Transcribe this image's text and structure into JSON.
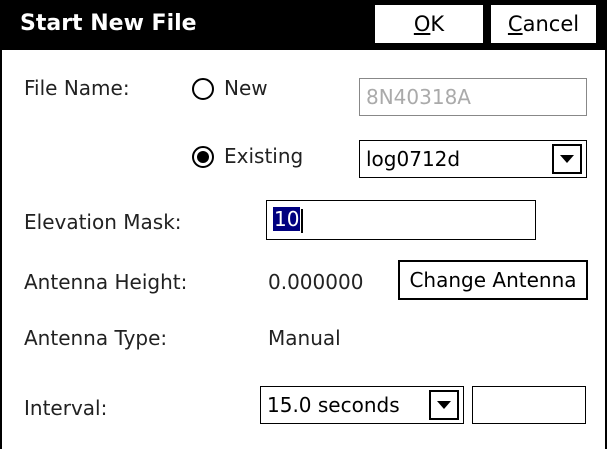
{
  "dialog": {
    "title": "Start New File",
    "ok_prefix": "",
    "ok_mnemonic": "O",
    "ok_rest": "K",
    "cancel_mnemonic": "C",
    "cancel_rest": "ancel"
  },
  "file_name": {
    "label": "File Name:",
    "new_label": "New",
    "new_selected": false,
    "new_value": "8N40318A",
    "existing_label": "Existing",
    "existing_selected": true,
    "existing_value": "log0712d"
  },
  "elevation_mask": {
    "label": "Elevation Mask:",
    "value": "10"
  },
  "antenna_height": {
    "label": "Antenna Height:",
    "value": "0.000000",
    "change_button": "Change Antenna"
  },
  "antenna_type": {
    "label": "Antenna Type:",
    "value": "Manual"
  },
  "interval": {
    "label": "Interval:",
    "value": "15.0 seconds",
    "extra_value": ""
  },
  "icons": {
    "dropdown": "chevron-down-icon"
  }
}
